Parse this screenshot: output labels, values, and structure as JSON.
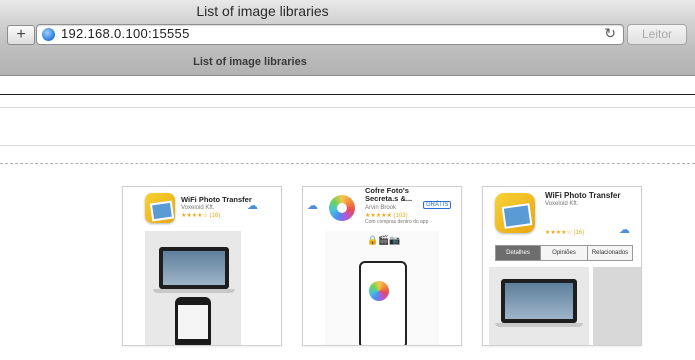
{
  "window": {
    "title": "List of image libraries"
  },
  "toolbar": {
    "add_label": "+",
    "url": "192.168.0.100:15555",
    "reload_symbol": "↻",
    "reader_label": "Leitor"
  },
  "tab": {
    "title": "List of image libraries"
  },
  "cards": [
    {
      "app_name": "WiFi Photo Transfer",
      "developer": "Voxeloid Kft.",
      "rating": "★★★★☆ (16)"
    },
    {
      "app_name": "Cofre Foto's Secreta.s &...",
      "developer": "Arvin Brook",
      "rating": "★★★★★ (103)",
      "subtext": "Com compras dentro do app",
      "price_label": "GRÁTIS"
    },
    {
      "app_name": "WiFi Photo Transfer",
      "developer": "Voxeloid Kft.",
      "rating": "★★★★☆ (16)",
      "tabs": [
        "Detalhes",
        "Opiniões",
        "Relacionados"
      ]
    }
  ],
  "icons": {
    "globe": "globe-icon",
    "reload": "reload-icon",
    "cloud_download": "cloud-download-icon",
    "photos": "photos-icon"
  }
}
